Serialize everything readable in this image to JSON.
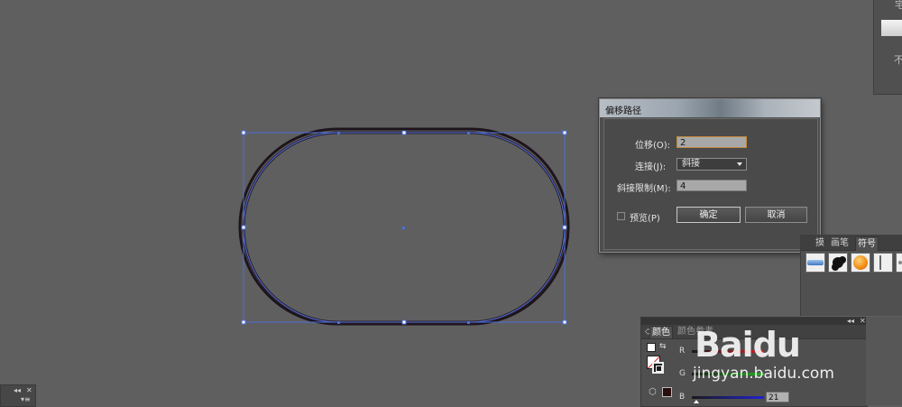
{
  "top_right_panel": {
    "label_top": "宅",
    "label_bottom": "不"
  },
  "dialog": {
    "title": "偏移路径",
    "offset": {
      "label": "位移(O):",
      "value": "2"
    },
    "join": {
      "label": "连接(J):",
      "value": "斜接"
    },
    "miter_limit": {
      "label": "斜接限制(M):",
      "value": "4"
    },
    "preview": {
      "label": "预览(P)"
    },
    "ok_label": "确定",
    "cancel_label": "取消"
  },
  "symbols_panel": {
    "tabs": [
      {
        "label": "摸"
      },
      {
        "label": "画笔"
      },
      {
        "label": "符号"
      }
    ],
    "swatches": [
      "blue-gradient-bar",
      "black-ink-splat",
      "orange-sphere",
      "white-brush",
      "grey-dots"
    ]
  },
  "color_panel": {
    "tabs": [
      {
        "label": "颜色"
      },
      {
        "label": "颜色参考"
      }
    ],
    "channels": [
      {
        "label": "R",
        "color": "#d42020"
      },
      {
        "label": "G",
        "color": "#20b020"
      },
      {
        "label": "B",
        "color": "#2020d0",
        "value": "21"
      }
    ]
  },
  "colors": {
    "canvas": "#5f5f5f",
    "selection": "#4c6ed8",
    "path": "#2a1c28"
  },
  "watermark": {
    "logo": "Baidu",
    "url": "jingyan.baidu.com"
  }
}
